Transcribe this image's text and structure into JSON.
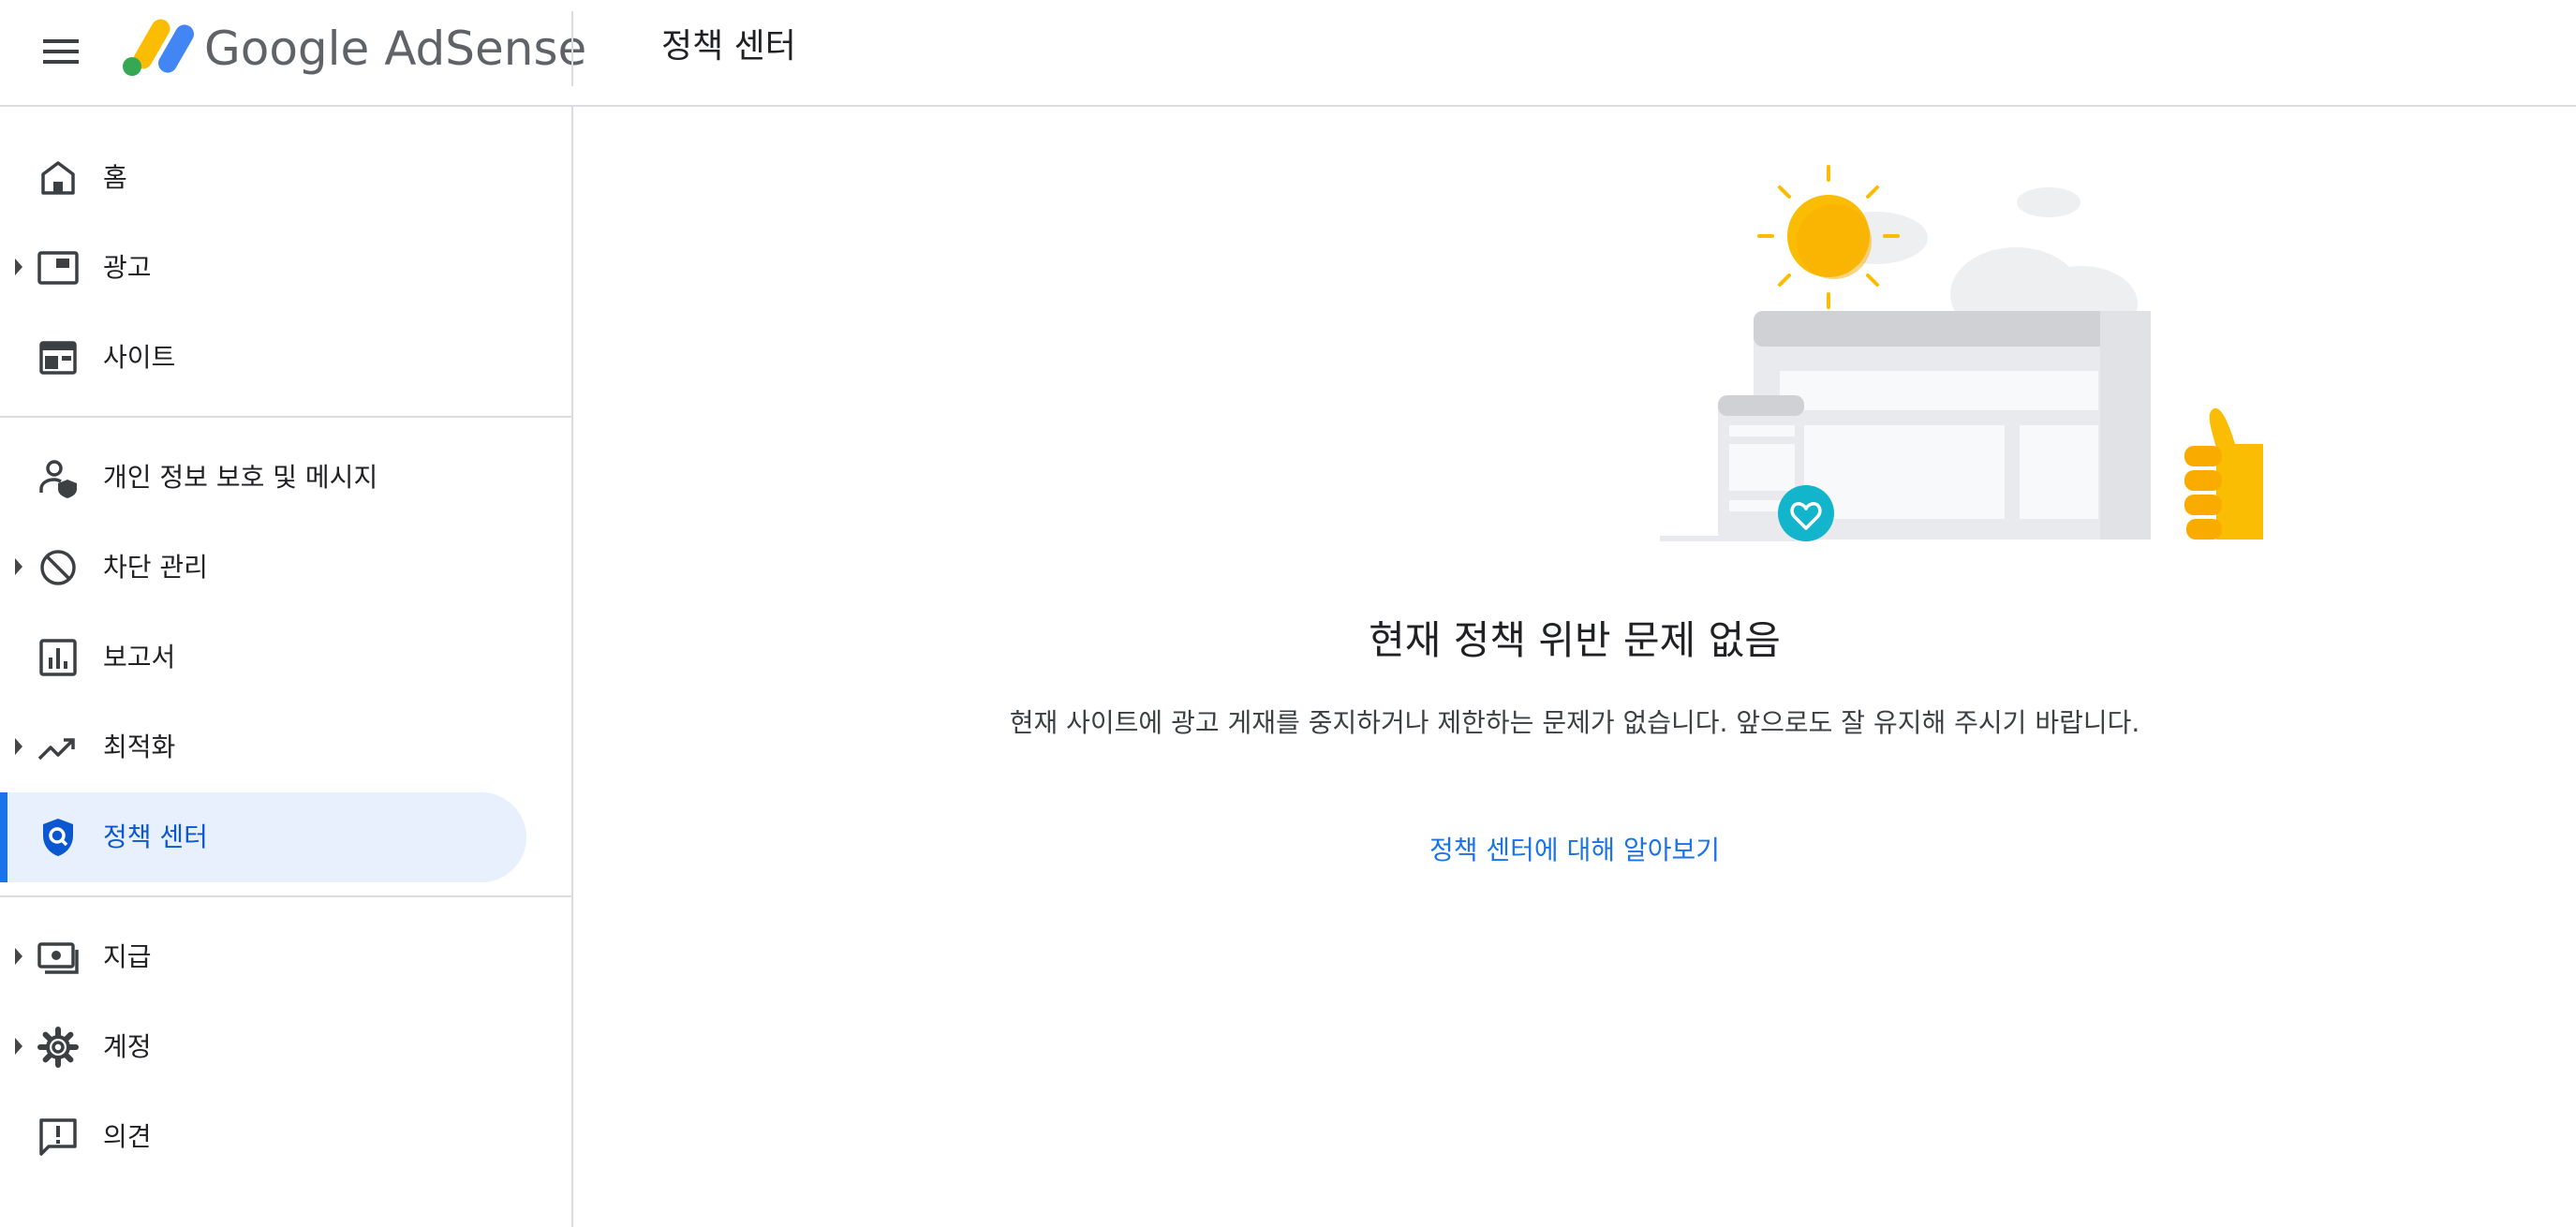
{
  "header": {
    "brand_google": "Google",
    "brand_product": "AdSense",
    "page_title": "정책 센터"
  },
  "sidebar": {
    "items": [
      {
        "label": "홈",
        "icon": "home-icon",
        "expandable": false
      },
      {
        "label": "광고",
        "icon": "ads-icon",
        "expandable": true
      },
      {
        "label": "사이트",
        "icon": "sites-icon",
        "expandable": false
      },
      {
        "label": "개인 정보 보호 및 메시지",
        "icon": "privacy-messaging-icon",
        "expandable": false
      },
      {
        "label": "차단 관리",
        "icon": "block-icon",
        "expandable": true
      },
      {
        "label": "보고서",
        "icon": "reports-icon",
        "expandable": false
      },
      {
        "label": "최적화",
        "icon": "trending-up-icon",
        "expandable": true
      },
      {
        "label": "정책 센터",
        "icon": "policy-shield-icon",
        "expandable": false,
        "active": true
      },
      {
        "label": "지급",
        "icon": "payments-icon",
        "expandable": true
      },
      {
        "label": "계정",
        "icon": "gear-icon",
        "expandable": true
      },
      {
        "label": "의견",
        "icon": "feedback-icon",
        "expandable": false
      }
    ]
  },
  "main": {
    "headline": "현재 정책 위반 문제 없음",
    "description": "현재 사이트에 광고 게재를 중지하거나 제한하는 문제가 없습니다. 앞으로도 잘 유지해 주시기 바랍니다.",
    "learn_more_link": "정책 센터에 대해 알아보기"
  },
  "colors": {
    "accent": "#1a73e8",
    "active_bg": "#e8f0fe",
    "sun": "#fbbc04",
    "heart_badge": "#12b5cb"
  }
}
